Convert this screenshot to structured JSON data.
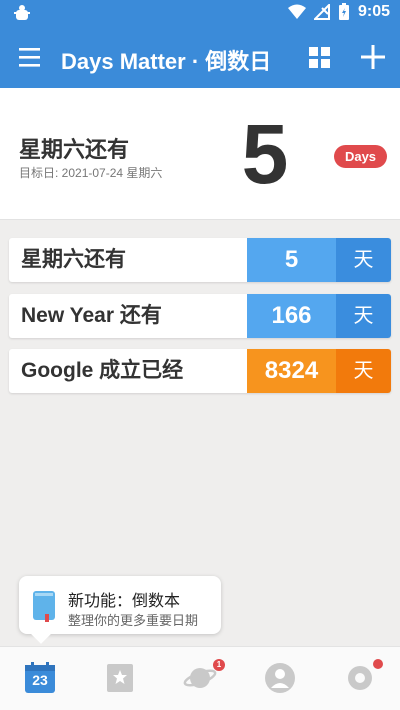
{
  "status_bar": {
    "left_icon": "bug-icon",
    "time": "9:05"
  },
  "toolbar": {
    "title": "Days Matter · 倒数日",
    "menu_icon": "hamburger-menu-icon",
    "grid_icon": "grid-view-icon",
    "add_icon": "add-icon"
  },
  "hero": {
    "title": "星期六还有",
    "subtitle": "目标日: 2021-07-24 星期六",
    "days": "5",
    "badge": "Days"
  },
  "events": [
    {
      "label": "星期六还有",
      "days": "5",
      "unit": "天",
      "color": "blue"
    },
    {
      "label": "New Year 还有",
      "days": "166",
      "unit": "天",
      "color": "blue"
    },
    {
      "label": "Google 成立已经",
      "days": "8324",
      "unit": "天",
      "color": "orange"
    }
  ],
  "tip": {
    "title": "新功能：倒数本",
    "subtitle": "整理你的更多重要日期"
  },
  "bottom_nav": {
    "items": [
      {
        "icon": "calendar-icon",
        "text": "23"
      },
      {
        "icon": "star-list-icon"
      },
      {
        "icon": "planet-icon",
        "badge": "1"
      },
      {
        "icon": "profile-icon"
      },
      {
        "icon": "settings-icon"
      }
    ]
  },
  "colors": {
    "primary": "#3b8bd9",
    "blue_light": "#54a7ef",
    "blue_dark": "#3a8dde",
    "orange_light": "#f7941e",
    "orange_dark": "#f27a0c",
    "badge_red": "#e04a4c"
  }
}
